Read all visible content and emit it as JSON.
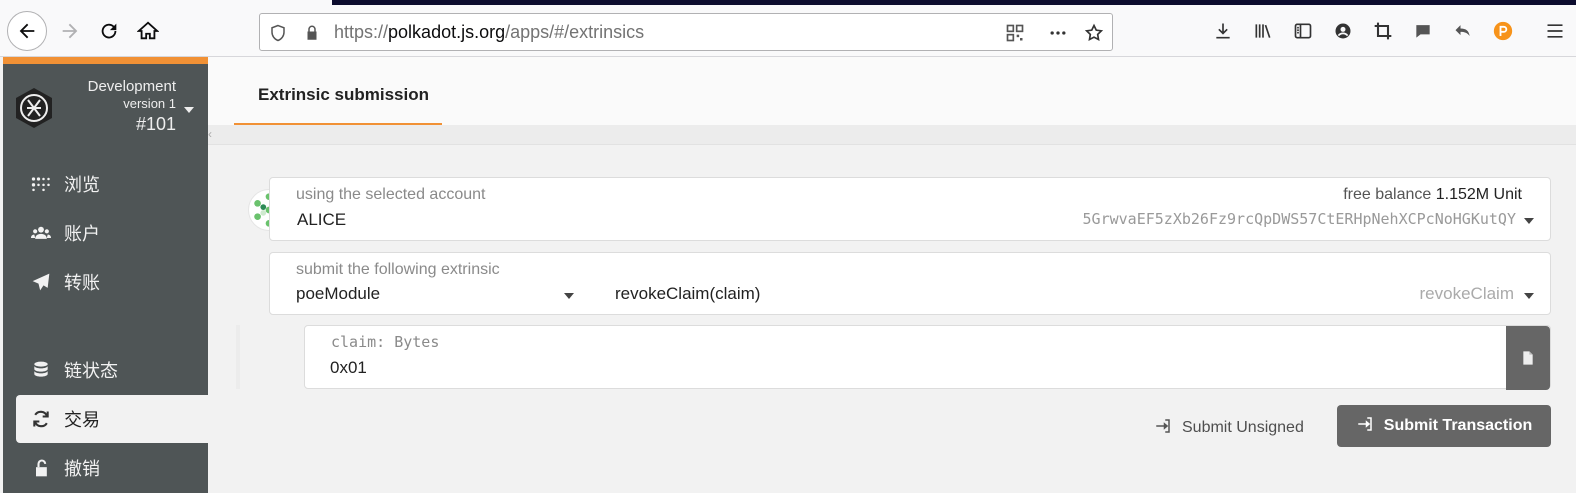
{
  "browser": {
    "url_prefix": "https://",
    "url_host": "polkadot.js.org",
    "url_path": "/apps/#/extrinsics"
  },
  "sidebar": {
    "chain_name": "Development",
    "chain_version": "version 1",
    "block_number": "#101",
    "items": [
      {
        "label": "浏览",
        "icon": "explorer-icon"
      },
      {
        "label": "账户",
        "icon": "accounts-icon"
      },
      {
        "label": "转账",
        "icon": "transfer-icon"
      },
      {
        "label": "链状态",
        "icon": "chainstate-icon"
      },
      {
        "label": "交易",
        "icon": "extrinsics-icon",
        "active": true
      },
      {
        "label": "撤销",
        "icon": "unlock-icon"
      }
    ]
  },
  "main": {
    "tab_label": "Extrinsic submission",
    "account": {
      "label": "using the selected account",
      "name": "ALICE",
      "balance_label": "free balance",
      "balance_value": "1.152M Unit",
      "address": "5GrwvaEF5zXb26Fz9rcQpDWS57CtERHpNehXCPcNoHGKutQY"
    },
    "extrinsic": {
      "label": "submit the following extrinsic",
      "module": "poeModule",
      "call": "revokeClaim(claim)",
      "call_hint": "revokeClaim"
    },
    "param": {
      "label": "claim: Bytes",
      "value": "0x01"
    },
    "actions": {
      "unsigned_label": "Submit Unsigned",
      "submit_label": "Submit Transaction"
    }
  },
  "colors": {
    "accent": "#f19135",
    "sidebar_bg": "#4f5556",
    "button_bg": "#666666"
  }
}
